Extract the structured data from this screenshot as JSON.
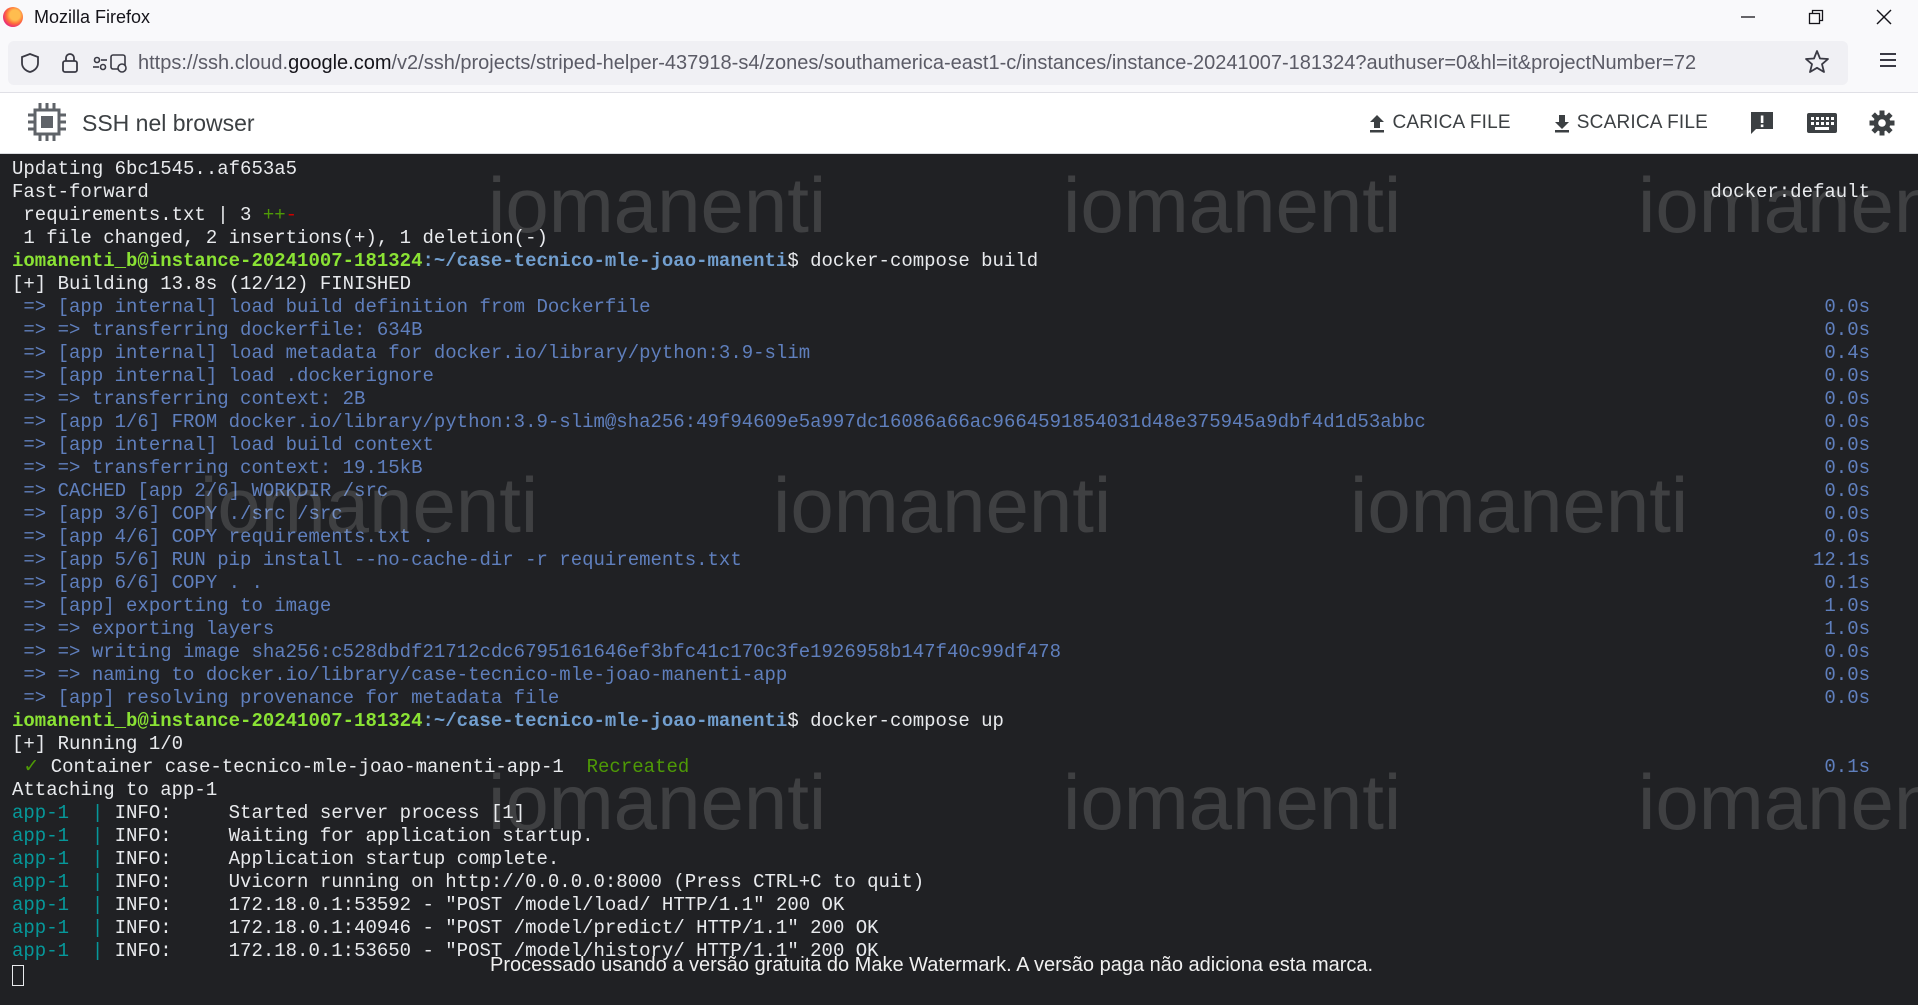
{
  "window": {
    "title": "Mozilla Firefox"
  },
  "browser": {
    "url_scheme": "https://ssh.cloud.",
    "url_host": "google.com",
    "url_path": "/v2/ssh/projects/striped-helper-437918-s4/zones/southamerica-east1-c/instances/instance-20241007-181324?authuser=0&hl=it&projectNumber=72"
  },
  "header": {
    "title": "SSH nel browser",
    "upload_label": "CARICA FILE",
    "download_label": "SCARICA FILE"
  },
  "terminal": {
    "lines": [
      "Updating 6bc1545..af653a5",
      "Fast-forward",
      " requirements.txt | 3 ++-",
      " 1 file changed, 2 insertions(+), 1 deletion(-)",
      "",
      "[+] Building 13.8s (12/12) FINISHED",
      " => [app internal] load build definition from Dockerfile",
      " => => transferring dockerfile: 634B",
      " => [app internal] load metadata for docker.io/library/python:3.9-slim",
      " => [app internal] load .dockerignore",
      " => => transferring context: 2B",
      " => [app 1/6] FROM docker.io/library/python:3.9-slim@sha256:49f94609e5a997dc16086a66ac9664591854031d48e375945a9dbf4d1d53abbc",
      " => [app internal] load build context",
      " => => transferring context: 19.15kB",
      " => CACHED [app 2/6] WORKDIR /src",
      " => [app 3/6] COPY ./src /src",
      " => [app 4/6] COPY requirements.txt .",
      " => [app 5/6] RUN pip install --no-cache-dir -r requirements.txt",
      " => [app 6/6] COPY . .",
      " => [app] exporting to image",
      " => => exporting layers",
      " => => writing image sha256:c528dbdf21712cdc6795161646ef3bfc41c170c3fe1926958b147f40c99df478",
      " => => naming to docker.io/library/case-tecnico-mle-joao-manenti-app",
      " => [app] resolving provenance for metadata file",
      "",
      "[+] Running 1/0",
      "",
      "Attaching to app-1",
      "",
      "",
      "",
      "",
      "",
      "",
      ""
    ],
    "right_values": {
      "1": "docker:default",
      "6": "0.0s",
      "7": "0.0s",
      "8": "0.4s",
      "9": "0.0s",
      "10": "0.0s",
      "11": "0.0s",
      "12": "0.0s",
      "13": "0.0s",
      "14": "0.0s",
      "15": "0.0s",
      "16": "0.0s",
      "17": "12.1s",
      "18": "0.1s",
      "19": "1.0s",
      "20": "1.0s",
      "21": "0.0s",
      "22": "0.0s",
      "23": "0.0s",
      "26": "0.1s"
    },
    "prompt_user": "iomanenti_b@instance-20241007-181324",
    "prompt_path": ":~/case-tecnico-mle-joao-manenti",
    "cmd_build": "$ docker-compose build",
    "cmd_up": "$ docker-compose up",
    "build_status_prefix": "[+] Building 13.8s (12/12) FINISHED",
    "container_check": " ✓ ",
    "container_name": "Container case-tecnico-mle-joao-manenti-app-1  ",
    "container_state": "Recreated",
    "log_prefix": "app-1",
    "log_sep": "  | ",
    "log_entries": [
      "INFO:     Started server process [1]",
      "INFO:     Waiting for application startup.",
      "INFO:     Application startup complete.",
      "INFO:     Uvicorn running on http://0.0.0.0:8000 (Press CTRL+C to quit)",
      "INFO:     172.18.0.1:53592 - \"POST /model/load/ HTTP/1.1\" 200 OK",
      "INFO:     172.18.0.1:40946 - \"POST /model/predict/ HTTP/1.1\" 200 OK",
      "INFO:     172.18.0.1:53650 - \"POST /model/history/ HTTP/1.1\" 200 OK"
    ]
  },
  "watermark": {
    "text": "iomanenti",
    "note": "Processado usando a versão gratuita do Make Watermark. A versão paga não adiciona esta marca."
  }
}
